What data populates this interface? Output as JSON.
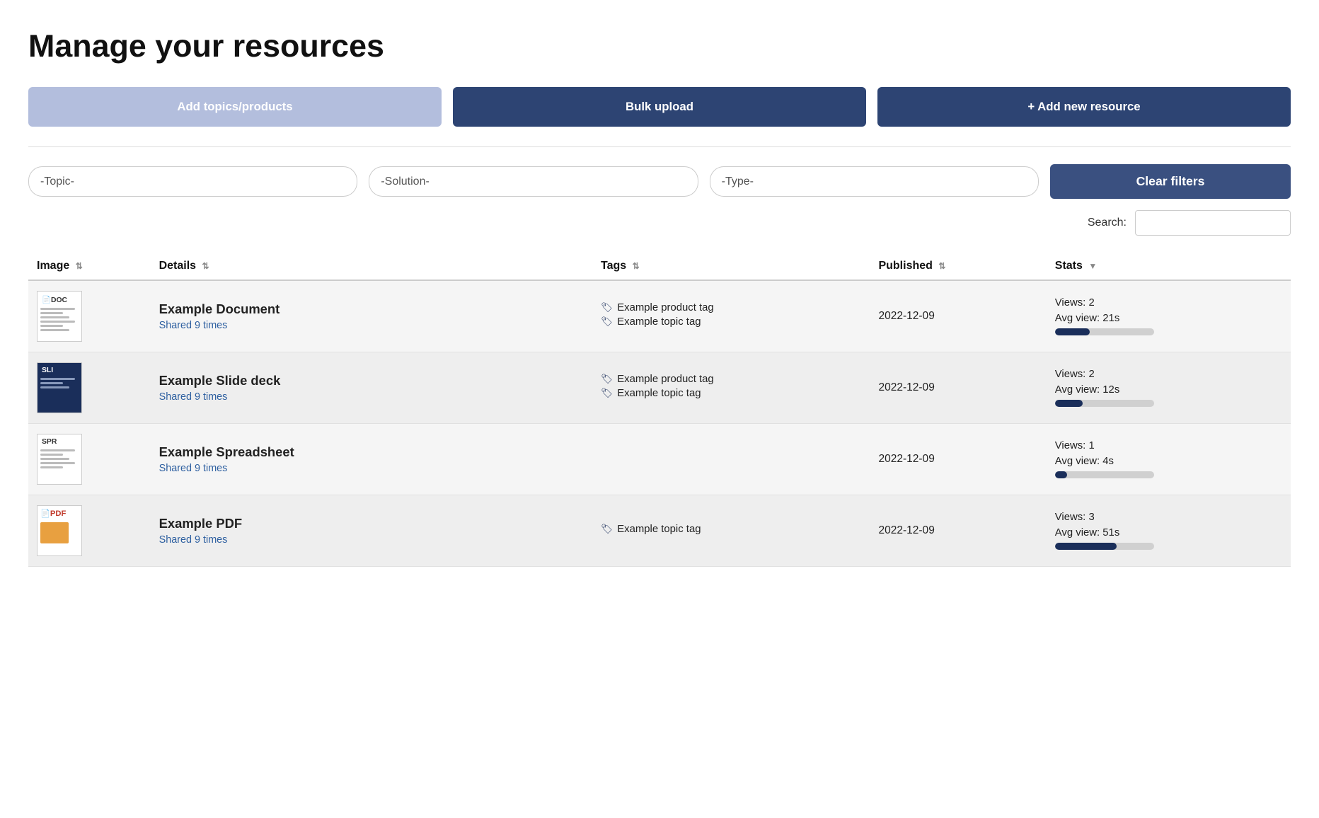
{
  "page": {
    "title": "Manage your resources"
  },
  "buttons": {
    "add_topics": "Add topics/products",
    "bulk_upload": "Bulk upload",
    "add_resource": "+ Add new resource",
    "clear_filters": "Clear filters"
  },
  "filters": {
    "topic_placeholder": "-Topic-",
    "solution_placeholder": "-Solution-",
    "type_placeholder": "-Type-"
  },
  "search": {
    "label": "Search:",
    "placeholder": ""
  },
  "table": {
    "headers": {
      "image": "Image",
      "details": "Details",
      "tags": "Tags",
      "published": "Published",
      "stats": "Stats"
    },
    "rows": [
      {
        "id": "row-1",
        "thumb_type": "DOC",
        "name": "Example Document",
        "shared": "Shared 9 times",
        "tags": [
          {
            "label": "Example product tag"
          },
          {
            "label": "Example topic tag"
          }
        ],
        "published": "2022-12-09",
        "stats_views": "Views: 2",
        "stats_avg": "Avg view: 21s",
        "bar_pct": 35
      },
      {
        "id": "row-2",
        "thumb_type": "SLI",
        "name": "Example Slide deck",
        "shared": "Shared 9 times",
        "tags": [
          {
            "label": "Example product tag"
          },
          {
            "label": "Example topic tag"
          }
        ],
        "published": "2022-12-09",
        "stats_views": "Views: 2",
        "stats_avg": "Avg view: 12s",
        "bar_pct": 28
      },
      {
        "id": "row-3",
        "thumb_type": "SPR",
        "name": "Example Spreadsheet",
        "shared": "Shared 9 times",
        "tags": [],
        "published": "2022-12-09",
        "stats_views": "Views: 1",
        "stats_avg": "Avg view: 4s",
        "bar_pct": 12
      },
      {
        "id": "row-4",
        "thumb_type": "PDF",
        "name": "Example PDF",
        "shared": "Shared 9 times",
        "tags": [
          {
            "label": "Example topic tag"
          }
        ],
        "published": "2022-12-09",
        "stats_views": "Views: 3",
        "stats_avg": "Avg view: 51s",
        "bar_pct": 62
      }
    ]
  }
}
